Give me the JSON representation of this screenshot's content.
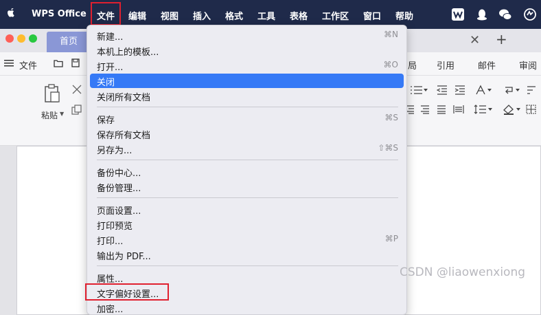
{
  "menubar": {
    "app_name": "WPS Office",
    "items": [
      "文件",
      "编辑",
      "视图",
      "插入",
      "格式",
      "工具",
      "表格",
      "工作区",
      "窗口",
      "帮助"
    ],
    "active_item": "文件",
    "tray_icons": [
      "wps-icon",
      "qq-icon",
      "wechat-icon",
      "settings-icon"
    ]
  },
  "window": {
    "home_tab": "首页",
    "toolbar": {
      "file_label": "文件",
      "right_labels": [
        "局",
        "引用",
        "邮件",
        "审阅"
      ]
    },
    "ribbon": {
      "paste_label": "粘贴"
    }
  },
  "file_menu": {
    "items": [
      {
        "label": "新建...",
        "shortcut": "⌘N"
      },
      {
        "label": "本机上的模板...",
        "shortcut": ""
      },
      {
        "label": "打开...",
        "shortcut": "⌘O"
      },
      {
        "label": "关闭",
        "shortcut": "",
        "selected": true
      },
      {
        "label": "关闭所有文档",
        "shortcut": ""
      },
      {
        "label": "保存",
        "shortcut": "⌘S"
      },
      {
        "label": "保存所有文档",
        "shortcut": ""
      },
      {
        "label": "另存为...",
        "shortcut": "⇧⌘S"
      },
      {
        "label": "备份中心...",
        "shortcut": ""
      },
      {
        "label": "备份管理...",
        "shortcut": ""
      },
      {
        "label": "页面设置...",
        "shortcut": ""
      },
      {
        "label": "打印预览",
        "shortcut": ""
      },
      {
        "label": "打印...",
        "shortcut": "⌘P"
      },
      {
        "label": "输出为 PDF...",
        "shortcut": ""
      },
      {
        "label": "属性...",
        "shortcut": ""
      },
      {
        "label": "文字偏好设置...",
        "shortcut": ""
      },
      {
        "label": "加密...",
        "shortcut": ""
      }
    ]
  },
  "watermark": "CSDN @liaowenxiong",
  "colors": {
    "menubar_bg": "#1f2a4a",
    "selection": "#3579f6",
    "annotation_red": "#e0202f"
  }
}
